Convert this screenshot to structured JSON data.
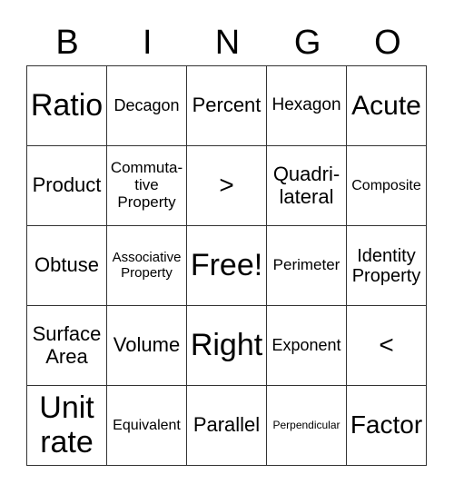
{
  "header": [
    "B",
    "I",
    "N",
    "G",
    "O"
  ],
  "cells": [
    [
      {
        "text": "Ratio",
        "size": 34
      },
      {
        "text": "Decagon",
        "size": 18
      },
      {
        "text": "Percent",
        "size": 22
      },
      {
        "text": "Hexagon",
        "size": 19
      },
      {
        "text": "Acute",
        "size": 30
      }
    ],
    [
      {
        "text": "Product",
        "size": 22
      },
      {
        "text": "Commuta-\ntive\nProperty",
        "size": 17
      },
      {
        "text": ">",
        "size": 28
      },
      {
        "text": "Quadri-\nlateral",
        "size": 22
      },
      {
        "text": "Composite",
        "size": 16
      }
    ],
    [
      {
        "text": "Obtuse",
        "size": 22
      },
      {
        "text": "Associative\nProperty",
        "size": 15
      },
      {
        "text": "Free!",
        "size": 34
      },
      {
        "text": "Perimeter",
        "size": 17
      },
      {
        "text": "Identity\nProperty",
        "size": 20
      }
    ],
    [
      {
        "text": "Surface\nArea",
        "size": 22
      },
      {
        "text": "Volume",
        "size": 22
      },
      {
        "text": "Right",
        "size": 34
      },
      {
        "text": "Exponent",
        "size": 18
      },
      {
        "text": "<",
        "size": 28
      }
    ],
    [
      {
        "text": "Unit\nrate",
        "size": 34
      },
      {
        "text": "Equivalent",
        "size": 16
      },
      {
        "text": "Parallel",
        "size": 22
      },
      {
        "text": "Perpendicular",
        "size": 12
      },
      {
        "text": "Factor",
        "size": 28
      }
    ]
  ]
}
